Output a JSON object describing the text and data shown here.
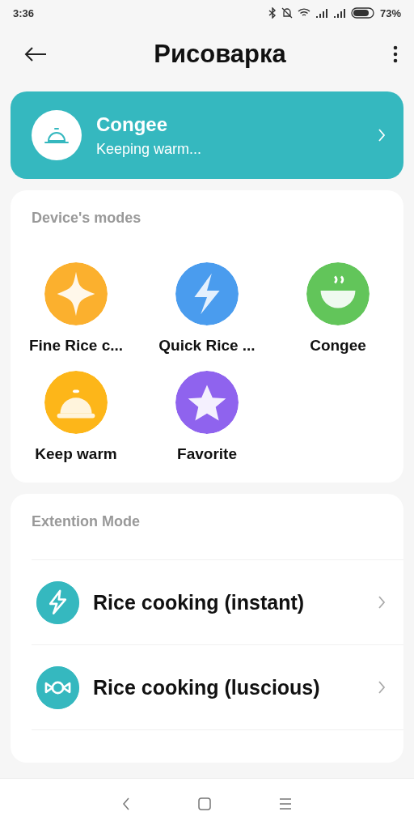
{
  "status_bar": {
    "time": "3:36",
    "battery": "73%"
  },
  "header": {
    "title": "Рисоварка"
  },
  "status_card": {
    "title": "Congee",
    "subtitle": "Keeping warm..."
  },
  "modes": {
    "title": "Device's modes",
    "items": [
      {
        "label": "Fine Rice c...",
        "kind": "sparkle",
        "color": "#fbb02e"
      },
      {
        "label": "Quick Rice ...",
        "kind": "bolt",
        "color": "#4a9cee"
      },
      {
        "label": "Congee",
        "kind": "bowl",
        "color": "#62c55a"
      },
      {
        "label": "Keep warm",
        "kind": "cloche",
        "color": "#fdb619"
      },
      {
        "label": "Favorite",
        "kind": "star",
        "color": "#8f63ee"
      }
    ]
  },
  "extension": {
    "title": "Extention Mode",
    "items": [
      {
        "label": "Rice cooking (instant)",
        "kind": "bolt"
      },
      {
        "label": "Rice cooking (luscious)",
        "kind": "candy"
      }
    ]
  }
}
